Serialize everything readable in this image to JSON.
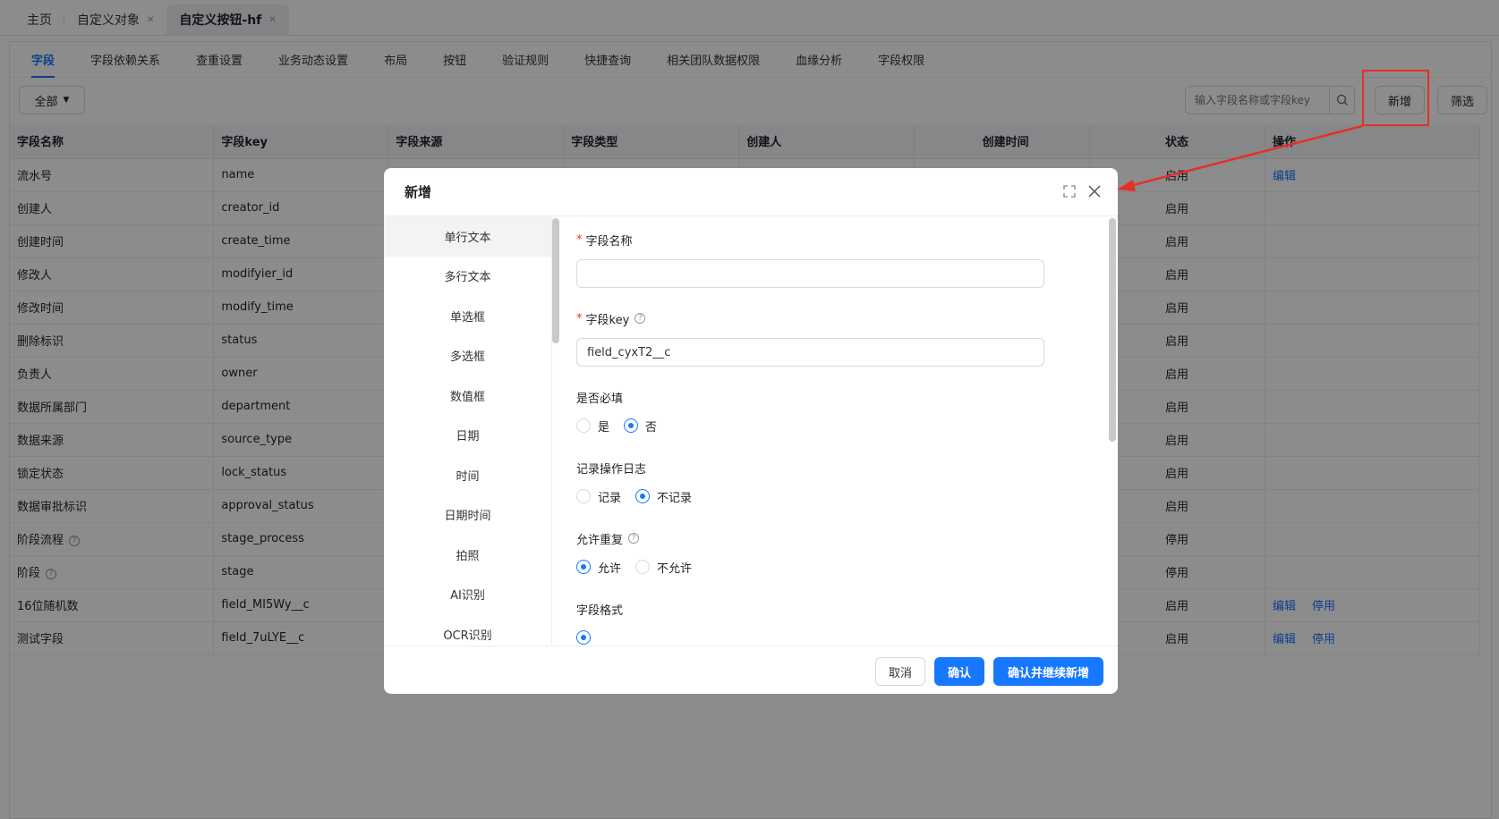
{
  "top_tabs": [
    {
      "label": "主页"
    },
    {
      "label": "自定义对象"
    },
    {
      "label": "自定义按钮-hf"
    }
  ],
  "sub_tabs": [
    "字段",
    "字段依赖关系",
    "查重设置",
    "业务动态设置",
    "布局",
    "按钮",
    "验证规则",
    "快捷查询",
    "相关团队数据权限",
    "血缘分析",
    "字段权限"
  ],
  "toolbar": {
    "all_label": "全部",
    "search_placeholder": "输入字段名称或字段key",
    "add_label": "新增",
    "filter_label": "筛选"
  },
  "table": {
    "columns": [
      "字段名称",
      "字段key",
      "字段来源",
      "字段类型",
      "创建人",
      "创建时间",
      "状态",
      "操作"
    ],
    "rows": [
      {
        "name": "流水号",
        "key": "name",
        "source": "",
        "type": "",
        "creator": "",
        "time": "",
        "status": "启用",
        "actions": [
          "编辑"
        ]
      },
      {
        "name": "创建人",
        "key": "creator_id",
        "status": "启用",
        "actions": []
      },
      {
        "name": "创建时间",
        "key": "create_time",
        "status": "启用",
        "actions": []
      },
      {
        "name": "修改人",
        "key": "modifyier_id",
        "status": "启用",
        "actions": []
      },
      {
        "name": "修改时间",
        "key": "modify_time",
        "status": "启用",
        "actions": []
      },
      {
        "name": "删除标识",
        "key": "status",
        "status": "启用",
        "actions": []
      },
      {
        "name": "负责人",
        "key": "owner",
        "status": "启用",
        "actions": []
      },
      {
        "name": "数据所属部门",
        "key": "department",
        "status": "启用",
        "actions": []
      },
      {
        "name": "数据来源",
        "key": "source_type",
        "status": "启用",
        "actions": []
      },
      {
        "name": "锁定状态",
        "key": "lock_status",
        "status": "启用",
        "actions": []
      },
      {
        "name": "数据审批标识",
        "key": "approval_status",
        "status": "启用",
        "actions": []
      },
      {
        "name": "阶段流程",
        "key": "stage_process",
        "status": "停用",
        "actions": [],
        "help": true
      },
      {
        "name": "阶段",
        "key": "stage",
        "status": "停用",
        "actions": [],
        "help": true
      },
      {
        "name": "16位随机数",
        "key": "field_MI5Wy__c",
        "status": "启用",
        "actions": [
          "编辑",
          "停用"
        ]
      },
      {
        "name": "测试字段",
        "key": "field_7uLYE__c",
        "status": "启用",
        "actions": [
          "编辑",
          "停用"
        ]
      }
    ]
  },
  "modal": {
    "title": "新增",
    "types": [
      "单行文本",
      "多行文本",
      "单选框",
      "多选框",
      "数值框",
      "日期",
      "时间",
      "日期时间",
      "拍照",
      "AI识别",
      "OCR识别"
    ],
    "field_name_label": "字段名称",
    "field_name_value": "",
    "field_key_label": "字段key",
    "field_key_value": "field_cyxT2__c",
    "required_label": "是否必填",
    "required_options": [
      "是",
      "否"
    ],
    "required_selected": "否",
    "log_label": "记录操作日志",
    "log_options": [
      "记录",
      "不记录"
    ],
    "log_selected": "不记录",
    "dup_label": "允许重复",
    "dup_options": [
      "允许",
      "不允许"
    ],
    "dup_selected": "允许",
    "format_label": "字段格式",
    "cancel_label": "取消",
    "confirm_label": "确认",
    "confirm_continue_label": "确认并继续新增"
  },
  "colors": {
    "primary": "#1677ff",
    "annotation": "#e5302a"
  }
}
